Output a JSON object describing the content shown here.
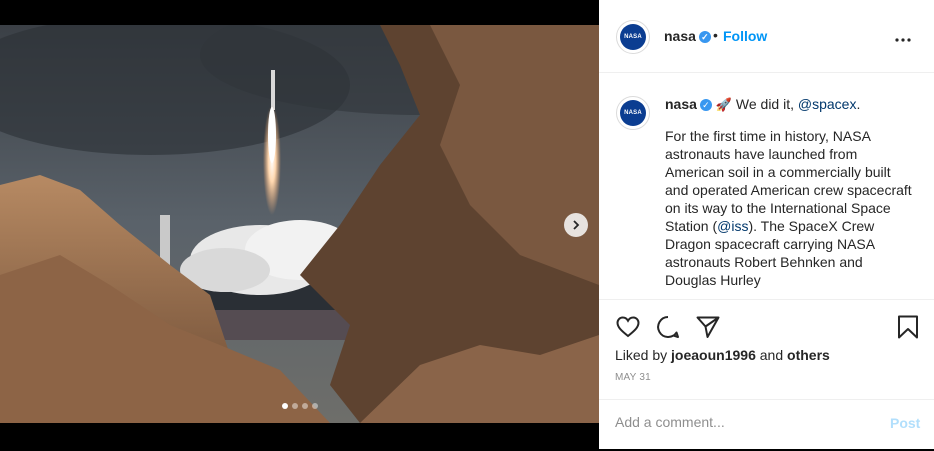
{
  "post": {
    "username": "nasa",
    "avatar_text": "NASA",
    "follow_label": "Follow",
    "separator": "•",
    "more_icon": "more-horizontal-icon",
    "caption": {
      "headline_pre": "We did it, ",
      "headline_mention": "@spacex",
      "headline_post": ".",
      "body_pre": "For the first time in history, NASA astronauts have launched from American soil in a commercially built and operated American crew spacecraft on its way to the International Space Station (",
      "body_mention": "@iss",
      "body_post": "). The SpaceX Crew Dragon spacecraft carrying NASA astronauts Robert Behnken and Douglas Hurley"
    },
    "likes": {
      "prefix": "Liked by ",
      "user": "joeaoun1996",
      "middle": " and ",
      "others": "others"
    },
    "date": "MAY 31",
    "comment": {
      "placeholder": "Add a comment...",
      "post_label": "Post"
    },
    "carousel": {
      "count": 4,
      "active_index": 0
    },
    "colors": {
      "follow": "#0095f6",
      "verified": "#3897f0",
      "mention": "#00376b",
      "post_disabled": "#b2dffc"
    }
  }
}
